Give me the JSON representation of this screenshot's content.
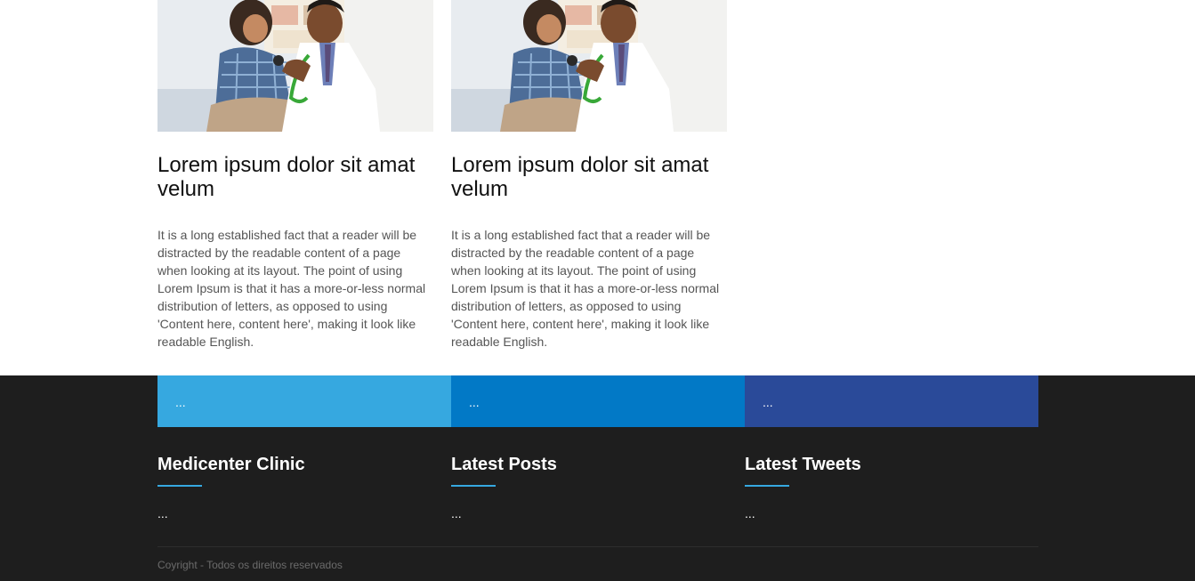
{
  "articles": [
    {
      "image_icon": "doctor-with-child-photo",
      "title": "Lorem ipsum dolor sit amat velum",
      "text": "It is a long established fact that a reader will be distracted by the readable content of a page when looking at its layout. The point of using Lorem Ipsum is that it has a more-or-less normal distribution of letters, as opposed to using 'Content here, content here', making it look like readable English."
    },
    {
      "image_icon": "doctor-with-child-photo",
      "title": "Lorem ipsum dolor sit amat velum",
      "text": "It is a long established fact that a reader will be distracted by the readable content of a page when looking at its layout. The point of using Lorem Ipsum is that it has a more-or-less normal distribution of letters, as opposed to using 'Content here, content here', making it look like readable English."
    }
  ],
  "footer": {
    "bars": [
      {
        "label": "...",
        "color": "#36a8e0"
      },
      {
        "label": "...",
        "color": "#0279c6"
      },
      {
        "label": "...",
        "color": "#2a4a99"
      }
    ],
    "columns": [
      {
        "heading": "Medicenter Clinic",
        "body": "..."
      },
      {
        "heading": "Latest Posts",
        "body": "..."
      },
      {
        "heading": "Latest Tweets",
        "body": "..."
      }
    ],
    "copyright": "Coyright - Todos os direitos reservados",
    "underline_color": "#36a8e0",
    "background": "#1e1e1e"
  }
}
